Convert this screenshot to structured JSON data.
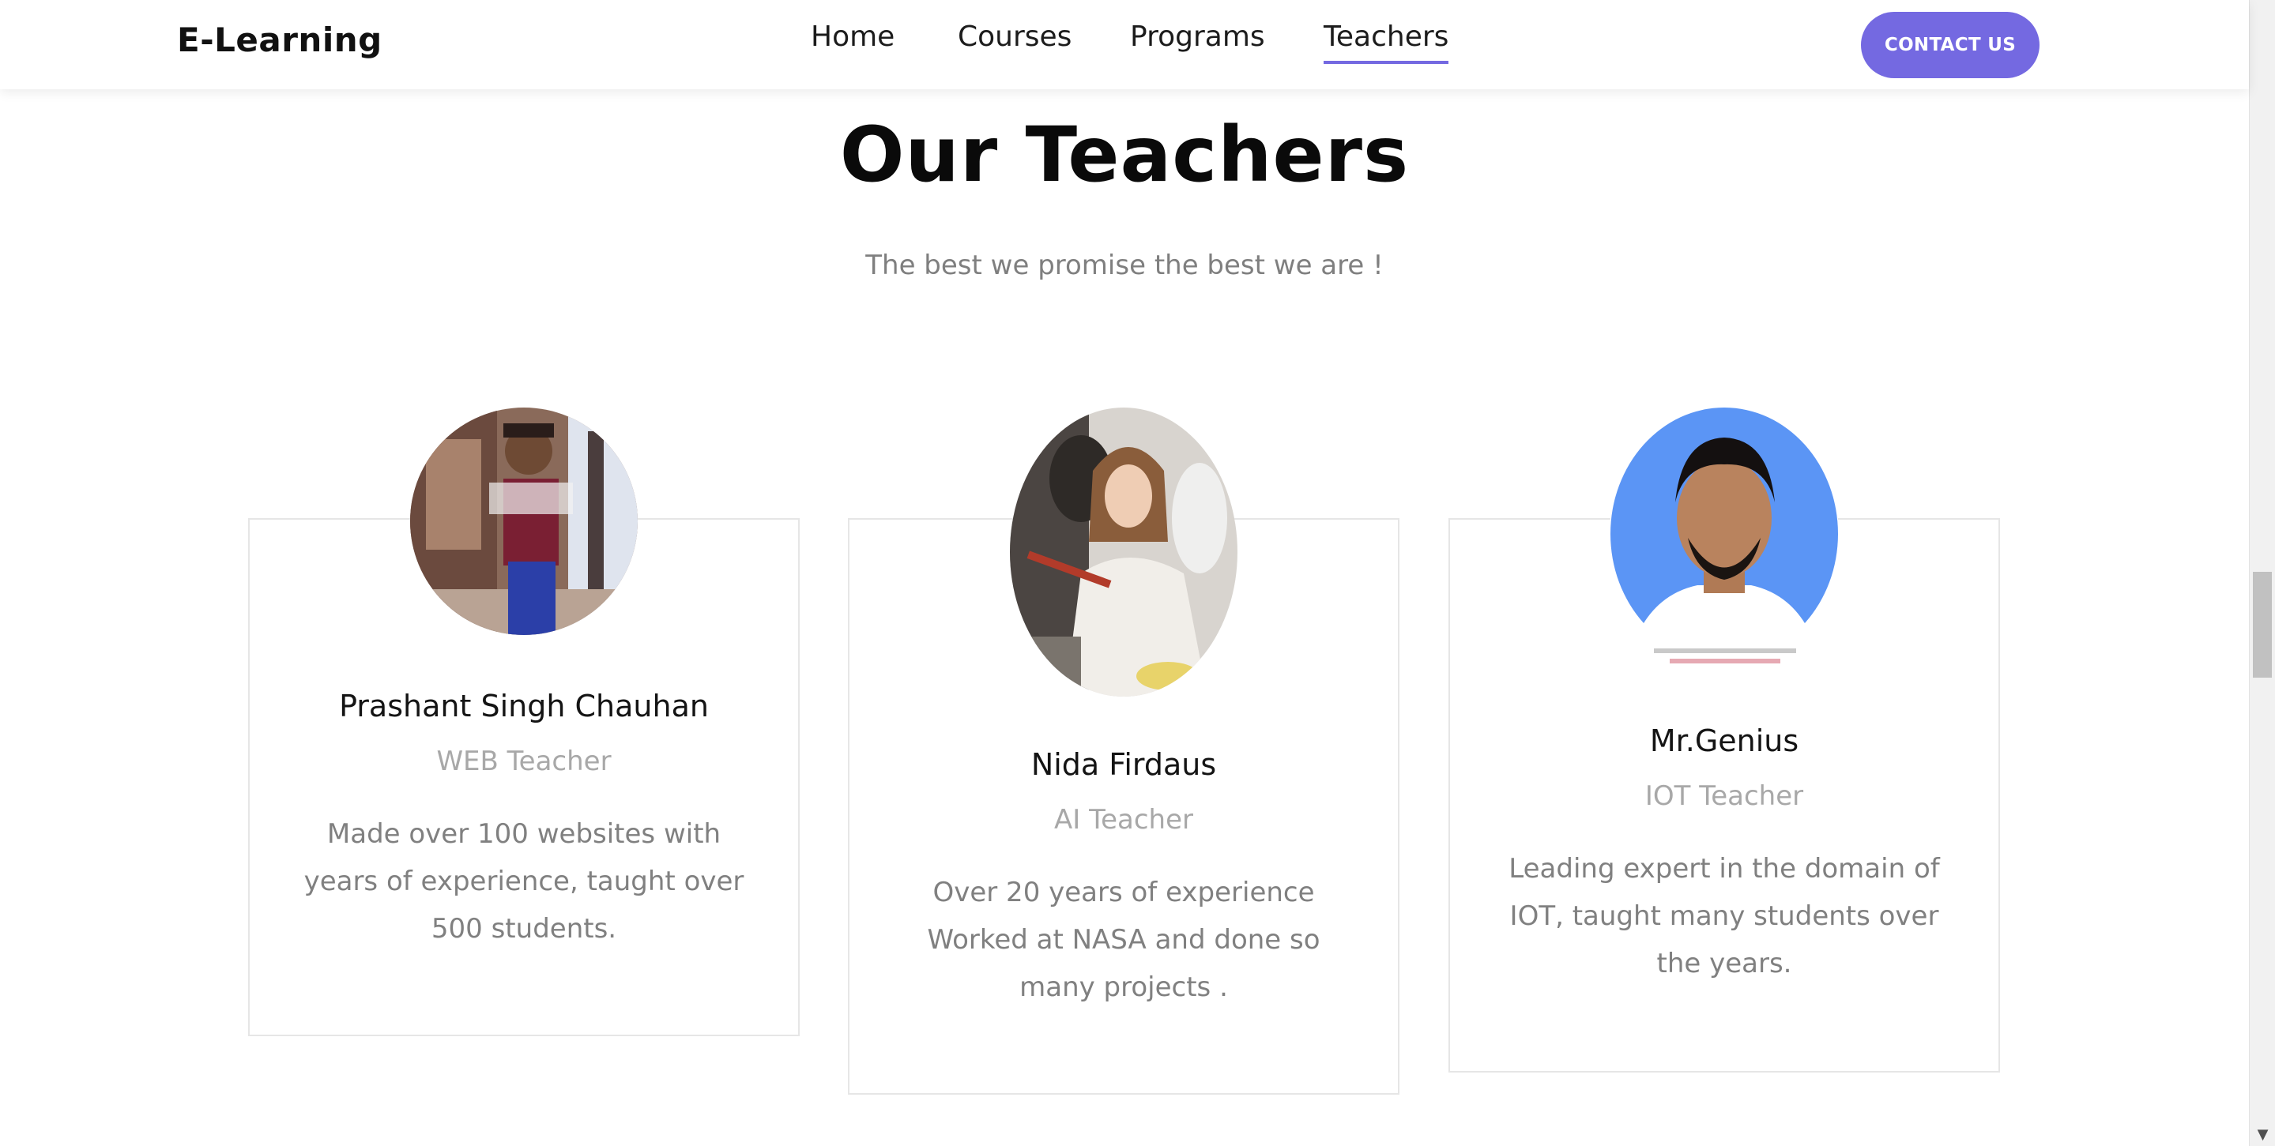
{
  "header": {
    "brand": "E-Learning",
    "nav": [
      {
        "label": "Home",
        "active": false
      },
      {
        "label": "Courses",
        "active": false
      },
      {
        "label": "Programs",
        "active": false
      },
      {
        "label": "Teachers",
        "active": true
      }
    ],
    "contact_label": "CONTACT US",
    "accent_color": "#7469e1"
  },
  "section": {
    "title": "Our Teachers",
    "subtitle": "The best we promise the best we are !"
  },
  "teachers": [
    {
      "name": "Prashant Singh Chauhan",
      "role": "WEB Teacher",
      "description": "Made over 100 websites with years of experience, taught over 500 students."
    },
    {
      "name": "Nida Firdaus",
      "role": "AI Teacher",
      "description": "Over 20 years of experience Worked at NASA and done so many projects ."
    },
    {
      "name": "Mr.Genius",
      "role": "IOT Teacher",
      "description": "Leading expert in the domain of IOT, taught many students over the years."
    }
  ],
  "icons": {
    "scroll_down": "scroll-down-arrow-icon"
  }
}
